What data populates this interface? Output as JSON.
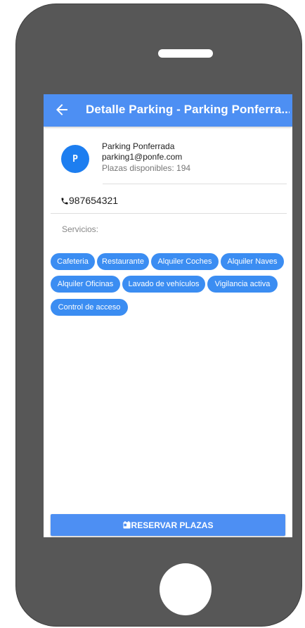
{
  "app_bar": {
    "title": "Detalle Parking - Parking Ponferra..."
  },
  "parking": {
    "avatar_letter": "P",
    "name": "Parking Ponferrada",
    "email": "parking1@ponfe.com",
    "available": "Plazas disponibles: 194",
    "phone": "987654321"
  },
  "services": {
    "label": "Servicios:",
    "chips": [
      "Cafeteria",
      "Restaurante",
      "Alquiler Coches",
      "Alquiler Naves",
      "Alquiler Oficinas",
      "Lavado de vehículos",
      "Vigilancia activa",
      "Control de acceso"
    ]
  },
  "reserve_button": {
    "label": "RESERVAR PLAZAS"
  },
  "colors": {
    "primary": "#4d8ff3",
    "avatar": "#1d7ef0",
    "phone_body": "#575757"
  },
  "icons": {
    "back": "arrow-left-icon",
    "phone": "phone-icon",
    "reserve": "calendar-icon"
  }
}
